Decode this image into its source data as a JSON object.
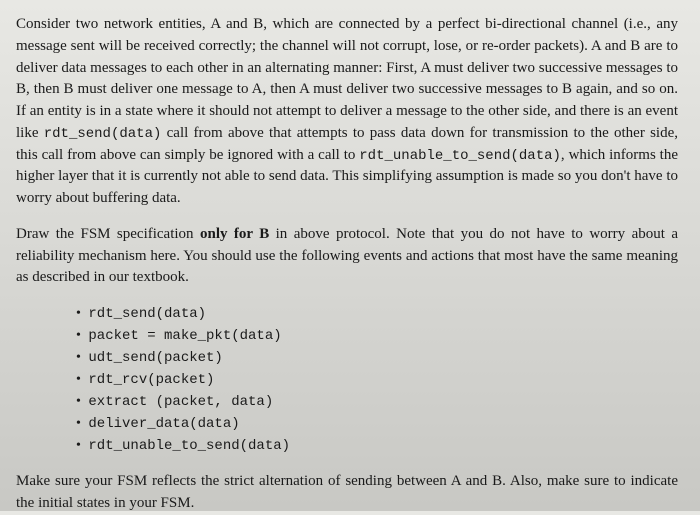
{
  "para1_part1": "Consider two network entities, A and B, which are connected by a perfect bi-directional channel (i.e., any message sent will be received correctly; the channel will not corrupt, lose, or re-order packets). A and B are to deliver data messages to each other in an alternating manner: First, A must deliver two successive messages to B, then B must deliver one message to A, then A must deliver two successive messages to B again, and so on. If an entity is in a state where it should not attempt to deliver a message to the other side, and there is an event like ",
  "code1": "rdt_send(data)",
  "para1_part2": " call from above that attempts to pass data down for transmission to the other side, this call from above can simply be ignored with a call to ",
  "code2": "rdt_unable_to_send(data)",
  "para1_part3": ", which informs the higher layer that it is currently not able to send data. This simplifying assumption is made so you don't have to worry about buffering data.",
  "para2_part1": "Draw the FSM specification ",
  "bold1": "only for B",
  "para2_part2": " in above protocol. Note that you do not have to worry about a reliability mechanism here. You should use the following events and actions that most have the same meaning as described in our textbook.",
  "bullets": [
    "rdt_send(data)",
    "packet = make_pkt(data)",
    "udt_send(packet)",
    "rdt_rcv(packet)",
    "extract (packet, data)",
    "deliver_data(data)",
    "rdt_unable_to_send(data)"
  ],
  "para3": "Make sure your FSM reflects the strict alternation of sending between A and B. Also, make sure to indicate the initial states in your FSM."
}
